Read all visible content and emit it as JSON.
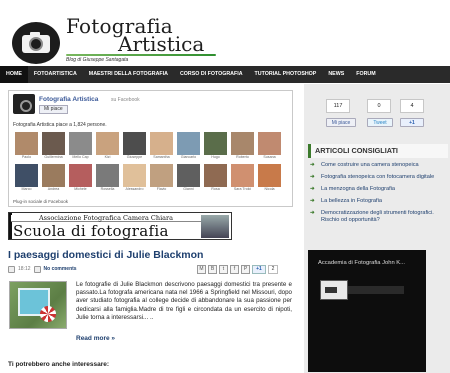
{
  "header": {
    "site_title_line1": "Fotografia",
    "site_title_line2": "Artistica",
    "subtitle": "Blog di Giuseppe Santagata"
  },
  "nav": {
    "items": [
      "HOME",
      "FOTOARTISTICA",
      "MAESTRI DELLA FOTOGRAFIA",
      "CORSO DI FOTOGRAFIA",
      "TUTORIAL PHOTOSHOP",
      "NEWS",
      "FORUM"
    ]
  },
  "fb_box": {
    "page_name": "Fotografia Artistica",
    "page_suffix": "su Facebook",
    "like_label": "Mi piace",
    "likes_text": "Fotografia Artistica piace a 1,824 persone.",
    "plugin_text": "Plug-in sociale di Facebook",
    "fans_row1": [
      "Paolo",
      "Guillermina",
      "Mello Cap",
      "Kizi",
      "Giuseppe",
      "Samantha",
      "Giancarlo",
      "Hugo",
      "Roberto",
      "Susana"
    ],
    "fans_row2": [
      "Marco",
      "Andrea",
      "Michele",
      "Rossella",
      "Alessandro",
      "Flavio",
      "Gianni",
      "Rosa",
      "Sara Trolci",
      "Nicola"
    ]
  },
  "banner": {
    "top_text": "Associazione Fotografica Camera Chiara",
    "main_text": "Scuola di fotografia"
  },
  "post": {
    "title": "I paesaggi domestici di Julie Blackmon",
    "date": "18:12",
    "comments": "No comments",
    "share_icons": [
      "M",
      "B",
      "t",
      "f",
      "P"
    ],
    "gplus_label": "+1",
    "gplus_count": "2",
    "body": "Le fotografie di Julie Blackmon descrivono paesaggi domestici tra presente e passato.La fotografa americana nata nel 1966 a Springfield nel Missouri, dopo aver studiato fotografia al college decide di abbandonare la sua passione per dedicarsi alla famiglia.Madre di tre figli e circondata da un esercito di nipoti, Julie torna a interessarsi... ..",
    "read_more": "Read more »"
  },
  "also_title": "Ti potrebbero anche interessare:",
  "sidebar": {
    "social": {
      "fb_count": "117",
      "fb_label": "Mi piace",
      "tw_count": "0",
      "tw_label": "Tweet",
      "gp_count": "4",
      "gp_label": "+1"
    },
    "articles_title": "ARTICOLI CONSIGLIATI",
    "articles": [
      "Come costruire una camera stenopeica",
      "Fotografia stenopeica con fotocamera digitale",
      "La menzogna della Fotografia",
      "La bellezza in Fotografia",
      "Democratizzazione degli strumenti fotografici. Rischio od opportunità?"
    ],
    "video_title": "Accademia di Fotografia John K..."
  },
  "colors": {
    "nav_bg": "#2a2a2a",
    "link_blue": "#1e3f6e",
    "accent_green": "#3c7a2c",
    "facebook_blue": "#3b5998"
  }
}
